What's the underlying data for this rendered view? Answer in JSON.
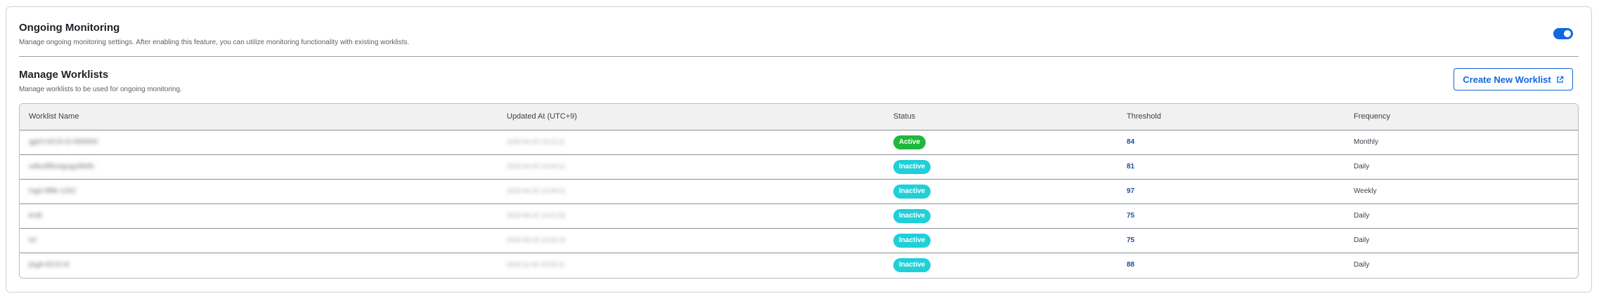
{
  "monitoring": {
    "title": "Ongoing Monitoring",
    "description": "Manage ongoing monitoring settings. After enabling this feature, you can utilize monitoring functionality with existing worklists.",
    "toggle_on": true
  },
  "worklists": {
    "title": "Manage Worklists",
    "description": "Manage worklists to be used for ongoing monitoring.",
    "create_button": "Create New Worklist",
    "columns": [
      "Worklist Name",
      "Updated At (UTC+9)",
      "Status",
      "Threshold",
      "Frequency"
    ],
    "rows": [
      {
        "name": "ggtr0-8215-l3 09/8500",
        "updated": "2025-06-20 13:12:11",
        "status": "Active",
        "threshold": "84",
        "frequency": "Monthly"
      },
      {
        "name": "odksdf8ssigugy88dfs",
        "updated": "2025-06-20 13:09:11",
        "status": "Inactive",
        "threshold": "81",
        "frequency": "Daily"
      },
      {
        "name": "hqjd-9f8k-1262",
        "updated": "2025-06-20 13:06:01",
        "status": "Inactive",
        "threshold": "97",
        "frequency": "Weekly"
      },
      {
        "name": "kndt",
        "updated": "2025-06-20 13:01:56",
        "status": "Inactive",
        "threshold": "75",
        "frequency": "Daily"
      },
      {
        "name": "tst",
        "updated": "2025-06-03 13:00:15",
        "status": "Inactive",
        "threshold": "75",
        "frequency": "Daily"
      },
      {
        "name": "jlsg8-8215-l4",
        "updated": "2025-11-06 13:05:11",
        "status": "Inactive",
        "threshold": "88",
        "frequency": "Daily"
      }
    ]
  },
  "colors": {
    "primary": "#1167e0",
    "active": "#1fb83c",
    "inactive": "#1ed0d8"
  }
}
